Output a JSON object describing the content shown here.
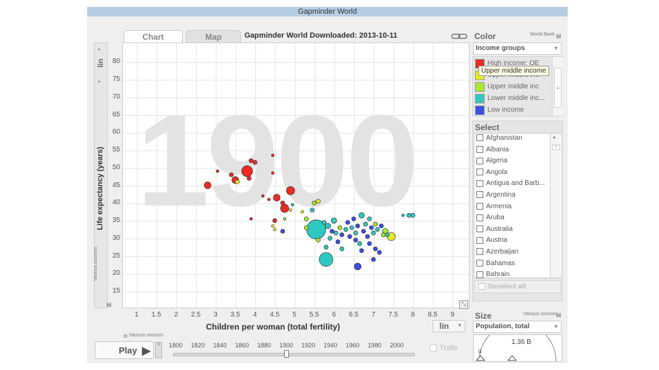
{
  "window": {
    "title": "Gapminder World"
  },
  "tabs": [
    {
      "label": "Chart"
    },
    {
      "label": "Map"
    }
  ],
  "downloaded_title": "Gapminder World Downloaded: 2013-10-11",
  "current_year": "1900",
  "y_axis": {
    "title": "Life expectancy (years)",
    "scale": "lin",
    "ticks": [
      "80",
      "75",
      "70",
      "65",
      "60",
      "55",
      "50",
      "45",
      "40",
      "35",
      "30",
      "25",
      "20",
      "15"
    ],
    "source": "Various sources"
  },
  "x_axis": {
    "title": "Children per woman (total fertility)",
    "scale": "lin",
    "ticks": [
      "1",
      "1.5",
      "2",
      "2.5",
      "3",
      "3.5",
      "4",
      "4.5",
      "5",
      "5.5",
      "6",
      "6.5",
      "7",
      "7.5",
      "8",
      "8.5",
      "9"
    ],
    "source": "Various sources"
  },
  "color_panel": {
    "title": "Color",
    "source": "World Bank",
    "selected": "Income groups",
    "items": [
      {
        "label": "High income: OE",
        "color": "#ee2a24"
      },
      {
        "label": "Upper middle inc",
        "color": "#e9e92a"
      },
      {
        "label": "Upper middle inc",
        "color": "#a9e92a"
      },
      {
        "label": "Lower middle inc...",
        "color": "#2fc8c0"
      },
      {
        "label": "Low income",
        "color": "#3a4fe8"
      }
    ],
    "tooltip": "Upper middle income"
  },
  "select_panel": {
    "title": "Select",
    "countries": [
      "Afghanistan",
      "Albania",
      "Algeria",
      "Angola",
      "Antigua and Barb...",
      "Argentina",
      "Armenia",
      "Aruba",
      "Australia",
      "Austria",
      "Azerbaijan",
      "Bahamas",
      "Bahrain"
    ],
    "deselect_label": "Deselect all"
  },
  "size_panel": {
    "title": "Size",
    "source": "Various sources",
    "selected": "Population, total",
    "value": "1.36 B",
    "min": "0"
  },
  "playback": {
    "play_label": "Play",
    "years": [
      "1800",
      "1820",
      "1840",
      "1860",
      "1880",
      "1900",
      "1920",
      "1940",
      "1960",
      "1980",
      "2000"
    ],
    "trails_label": "Trails"
  },
  "chart_data": {
    "type": "scatter",
    "x_label": "Children per woman (total fertility)",
    "y_label": "Life expectancy (years)",
    "xlim": [
      0.5,
      9.5
    ],
    "ylim": [
      11,
      84
    ],
    "points": [
      {
        "x": 2.8,
        "y": 45,
        "r": 5,
        "c": "#ee2a24"
      },
      {
        "x": 3.05,
        "y": 49,
        "r": 2,
        "c": "#ee2a24"
      },
      {
        "x": 3.4,
        "y": 48,
        "r": 3,
        "c": "#ee2a24"
      },
      {
        "x": 3.5,
        "y": 46.5,
        "r": 5,
        "c": "#ee2a24"
      },
      {
        "x": 3.55,
        "y": 46,
        "r": 3,
        "c": "#e9e92a"
      },
      {
        "x": 3.8,
        "y": 49,
        "r": 8,
        "c": "#ee2a24"
      },
      {
        "x": 3.85,
        "y": 47,
        "r": 3,
        "c": "#ee2a24"
      },
      {
        "x": 3.9,
        "y": 52,
        "r": 3,
        "c": "#ee2a24"
      },
      {
        "x": 4.0,
        "y": 51.5,
        "r": 3,
        "c": "#ee2a24"
      },
      {
        "x": 3.9,
        "y": 35.5,
        "r": 2,
        "c": "#ee2a24"
      },
      {
        "x": 4.45,
        "y": 53.5,
        "r": 2,
        "c": "#ee2a24"
      },
      {
        "x": 4.45,
        "y": 48.5,
        "r": 2,
        "c": "#ee2a24"
      },
      {
        "x": 4.2,
        "y": 42,
        "r": 2,
        "c": "#ee2a24"
      },
      {
        "x": 4.35,
        "y": 41,
        "r": 2,
        "c": "#ee2a24"
      },
      {
        "x": 4.55,
        "y": 41.5,
        "r": 5,
        "c": "#ee2a24"
      },
      {
        "x": 4.5,
        "y": 35,
        "r": 3,
        "c": "#ee2a24"
      },
      {
        "x": 4.7,
        "y": 40,
        "r": 3,
        "c": "#ee2a24"
      },
      {
        "x": 4.75,
        "y": 38.5,
        "r": 6,
        "c": "#ee2a24"
      },
      {
        "x": 4.9,
        "y": 43.5,
        "r": 6,
        "c": "#ee2a24"
      },
      {
        "x": 4.45,
        "y": 33.5,
        "r": 2,
        "c": "#e9e92a"
      },
      {
        "x": 4.5,
        "y": 32.5,
        "r": 2,
        "c": "#e9e92a"
      },
      {
        "x": 4.7,
        "y": 32,
        "r": 3,
        "c": "#3a4fe8"
      },
      {
        "x": 4.9,
        "y": 38,
        "r": 2,
        "c": "#e9e92a"
      },
      {
        "x": 4.75,
        "y": 35.5,
        "r": 2,
        "c": "#a9e92a"
      },
      {
        "x": 4.95,
        "y": 39.5,
        "r": 2,
        "c": "#2fc8c0"
      },
      {
        "x": 5.3,
        "y": 35.5,
        "r": 3,
        "c": "#a9e92a"
      },
      {
        "x": 5.5,
        "y": 40,
        "r": 3,
        "c": "#a9e92a"
      },
      {
        "x": 5.6,
        "y": 40.5,
        "r": 3,
        "c": "#e9e92a"
      },
      {
        "x": 5.45,
        "y": 38,
        "r": 3,
        "c": "#2fc8c0"
      },
      {
        "x": 5.2,
        "y": 37.5,
        "r": 2,
        "c": "#e9e92a"
      },
      {
        "x": 5.55,
        "y": 32.5,
        "r": 14,
        "c": "#2fc8c0"
      },
      {
        "x": 5.3,
        "y": 33,
        "r": 3,
        "c": "#a9e92a"
      },
      {
        "x": 5.6,
        "y": 29.5,
        "r": 3,
        "c": "#a9e92a"
      },
      {
        "x": 5.75,
        "y": 34.5,
        "r": 3,
        "c": "#2fc8c0"
      },
      {
        "x": 5.85,
        "y": 33.5,
        "r": 4,
        "c": "#2fc8c0"
      },
      {
        "x": 5.95,
        "y": 32,
        "r": 3,
        "c": "#3a4fe8"
      },
      {
        "x": 6.0,
        "y": 35,
        "r": 4,
        "c": "#2fc8c0"
      },
      {
        "x": 6.05,
        "y": 31.5,
        "r": 3,
        "c": "#2fc8c0"
      },
      {
        "x": 5.9,
        "y": 30,
        "r": 3,
        "c": "#2fc8c0"
      },
      {
        "x": 6.15,
        "y": 33,
        "r": 3,
        "c": "#a9e92a"
      },
      {
        "x": 6.2,
        "y": 31,
        "r": 3,
        "c": "#3a4fe8"
      },
      {
        "x": 6.3,
        "y": 32.5,
        "r": 3,
        "c": "#2fc8c0"
      },
      {
        "x": 6.35,
        "y": 34.5,
        "r": 3,
        "c": "#3a4fe8"
      },
      {
        "x": 6.4,
        "y": 30.5,
        "r": 3,
        "c": "#3a4fe8"
      },
      {
        "x": 6.45,
        "y": 33,
        "r": 3,
        "c": "#2fc8c0"
      },
      {
        "x": 6.5,
        "y": 35.5,
        "r": 3,
        "c": "#3a4fe8"
      },
      {
        "x": 6.55,
        "y": 31.5,
        "r": 3,
        "c": "#2fc8c0"
      },
      {
        "x": 6.6,
        "y": 33.5,
        "r": 3,
        "c": "#3a4fe8"
      },
      {
        "x": 6.7,
        "y": 36.5,
        "r": 4,
        "c": "#2fc8c0"
      },
      {
        "x": 6.75,
        "y": 32,
        "r": 3,
        "c": "#3a4fe8"
      },
      {
        "x": 6.8,
        "y": 34,
        "r": 3,
        "c": "#2fc8c0"
      },
      {
        "x": 6.85,
        "y": 30.5,
        "r": 3,
        "c": "#3a4fe8"
      },
      {
        "x": 6.9,
        "y": 35.5,
        "r": 3,
        "c": "#2fc8c0"
      },
      {
        "x": 6.95,
        "y": 33,
        "r": 3,
        "c": "#3a4fe8"
      },
      {
        "x": 7.0,
        "y": 31.5,
        "r": 3,
        "c": "#2fc8c0"
      },
      {
        "x": 7.05,
        "y": 34,
        "r": 3,
        "c": "#a9e92a"
      },
      {
        "x": 7.1,
        "y": 32.5,
        "r": 3,
        "c": "#2fc8c0"
      },
      {
        "x": 7.2,
        "y": 33.5,
        "r": 3,
        "c": "#3a4fe8"
      },
      {
        "x": 7.25,
        "y": 31,
        "r": 3,
        "c": "#a9e92a"
      },
      {
        "x": 7.3,
        "y": 32,
        "r": 4,
        "c": "#a9e92a"
      },
      {
        "x": 7.45,
        "y": 30.5,
        "r": 6,
        "c": "#e9e92a"
      },
      {
        "x": 7.35,
        "y": 31,
        "r": 3,
        "c": "#2fc8c0"
      },
      {
        "x": 6.55,
        "y": 29.5,
        "r": 3,
        "c": "#3a4fe8"
      },
      {
        "x": 6.65,
        "y": 28.5,
        "r": 3,
        "c": "#2fc8c0"
      },
      {
        "x": 6.9,
        "y": 28.5,
        "r": 3,
        "c": "#3a4fe8"
      },
      {
        "x": 6.1,
        "y": 29,
        "r": 3,
        "c": "#3a4fe8"
      },
      {
        "x": 5.8,
        "y": 27.5,
        "r": 3,
        "c": "#2fc8c0"
      },
      {
        "x": 6.2,
        "y": 27,
        "r": 3,
        "c": "#2fc8c0"
      },
      {
        "x": 6.7,
        "y": 26.5,
        "r": 3,
        "c": "#3a4fe8"
      },
      {
        "x": 7.05,
        "y": 27,
        "r": 3,
        "c": "#3a4fe8"
      },
      {
        "x": 7.15,
        "y": 26,
        "r": 3,
        "c": "#3a4fe8"
      },
      {
        "x": 5.8,
        "y": 24,
        "r": 10,
        "c": "#2fc8c0"
      },
      {
        "x": 6.6,
        "y": 22,
        "r": 5,
        "c": "#3a4fe8"
      },
      {
        "x": 7.0,
        "y": 24,
        "r": 3,
        "c": "#3a4fe8"
      },
      {
        "x": 7.9,
        "y": 36.5,
        "r": 3,
        "c": "#2fc8c0"
      },
      {
        "x": 8.0,
        "y": 36.5,
        "r": 3,
        "c": "#2fc8c0"
      },
      {
        "x": 7.75,
        "y": 36.5,
        "r": 2,
        "c": "#2fc8c0"
      }
    ]
  }
}
